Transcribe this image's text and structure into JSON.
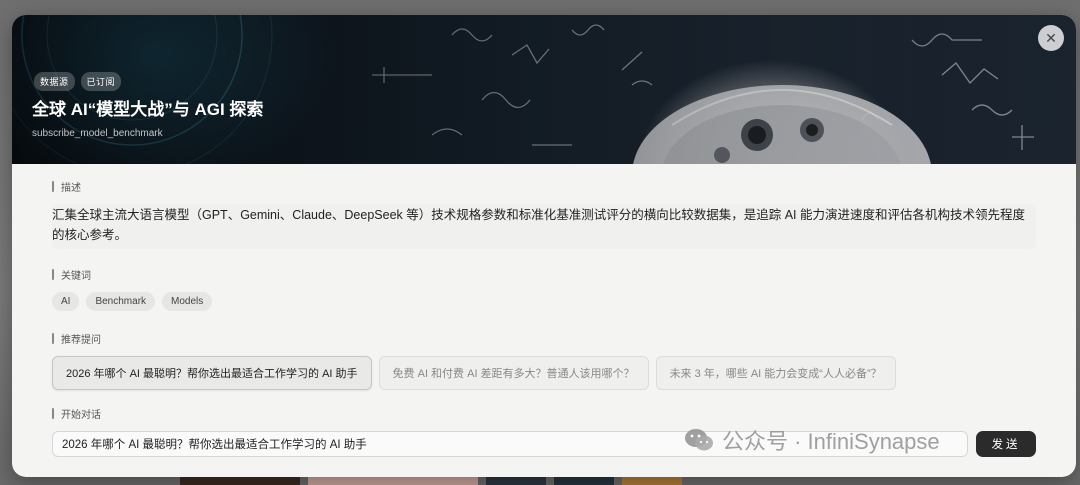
{
  "header": {
    "tags": [
      "数据源",
      "已订阅"
    ],
    "title": "全球 AI“模型大战”与 AGI 探索",
    "subtitle": "subscribe_model_benchmark",
    "close_icon": "close-icon"
  },
  "description": {
    "label": "描述",
    "text": "汇集全球主流大语言模型（GPT、Gemini、Claude、DeepSeek 等）技术规格参数和标准化基准测试评分的横向比较数据集，是追踪 AI 能力演进速度和评估各机构技术领先程度的核心参考。"
  },
  "keywords": {
    "label": "关键词",
    "items": [
      "AI",
      "Benchmark",
      "Models"
    ]
  },
  "suggested": {
    "label": "推荐提问",
    "items": [
      "2026 年哪个 AI 最聪明？帮你选出最适合工作学习的 AI 助手",
      "免费 AI 和付费 AI 差距有多大？普通人该用哪个？",
      "未来 3 年，哪些 AI 能力会变成“人人必备”？"
    ]
  },
  "chat": {
    "label": "开始对话",
    "input_value": "2026 年哪个 AI 最聪明？帮你选出最适合工作学习的 AI 助手",
    "send_label": "发送"
  },
  "watermark": {
    "text": "公众号 · InfiniSynapse",
    "icon": "wechat-icon"
  }
}
